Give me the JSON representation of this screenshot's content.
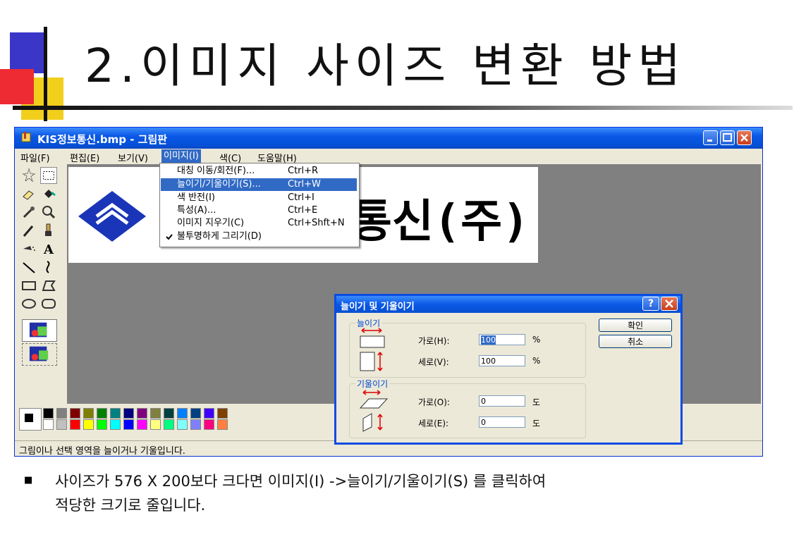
{
  "slide": {
    "title": "2.이미지 사이즈 변환 방법",
    "bullet_symbol": "■",
    "body_line1": "사이즈가 576 X 200보다 크다면 이미지(I) ->늘이기/기울이기(S) 를 클릭하여",
    "body_line2": "적당한 크기로 줄입니다."
  },
  "paint": {
    "title": "KIS정보통신.bmp - 그림판",
    "menu": [
      "파일(F)",
      "편집(E)",
      "보기(V)",
      "이미지(I)",
      "색(C)",
      "도움말(H)"
    ],
    "image_text": "통신(주)",
    "status": "그림이나 선택 영역을 늘이거나 기울입니다."
  },
  "image_menu": [
    {
      "label": "대칭 이동/회전(F)...",
      "shortcut": "Ctrl+R"
    },
    {
      "label": "늘이기/기울이기(S)...",
      "shortcut": "Ctrl+W"
    },
    {
      "label": "색 반전(I)",
      "shortcut": "Ctrl+I"
    },
    {
      "label": "특성(A)...",
      "shortcut": "Ctrl+E"
    },
    {
      "label": "이미지 지우기(C)",
      "shortcut": "Ctrl+Shft+N"
    },
    {
      "label": "불투명하게 그리기(D)",
      "shortcut": ""
    }
  ],
  "dialog": {
    "title": "늘이기 및 기울이기",
    "help_button": "?",
    "stretch_group": "늘이기",
    "skew_group": "기울이기",
    "stretch_h_label": "가로(H):",
    "stretch_h_value": "100",
    "stretch_v_label": "세로(V):",
    "stretch_v_value": "100",
    "percent_unit": "%",
    "skew_h_label": "가로(O):",
    "skew_h_value": "0",
    "skew_v_label": "세로(E):",
    "skew_v_value": "0",
    "degree_unit": "도",
    "ok_label": "확인",
    "cancel_label": "취소"
  },
  "palette_colors": {
    "row1": [
      "#000000",
      "#808080",
      "#800000",
      "#808000",
      "#008000",
      "#008080",
      "#000080",
      "#800080",
      "#808040",
      "#004040",
      "#0080ff",
      "#004080",
      "#4000ff",
      "#804000"
    ],
    "row2": [
      "#ffffff",
      "#c0c0c0",
      "#ff0000",
      "#ffff00",
      "#00ff00",
      "#00ffff",
      "#0000ff",
      "#ff00ff",
      "#ffff80",
      "#00ff80",
      "#80ffff",
      "#8080ff",
      "#ff0080",
      "#ff8040"
    ]
  },
  "colors": {
    "xp_title_blue": "#0a58e6",
    "menu_highlight": "#316ac5",
    "window_face": "#ece9d8"
  }
}
